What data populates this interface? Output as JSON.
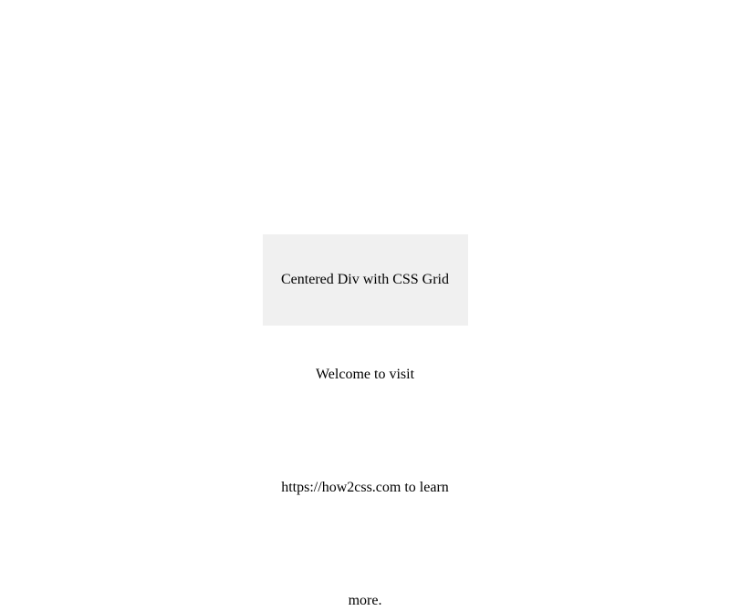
{
  "box": {
    "text": "Centered Div with CSS Grid"
  },
  "lines": {
    "line1": "Welcome to visit",
    "line2": "https://how2css.com to learn",
    "line3": "more."
  }
}
